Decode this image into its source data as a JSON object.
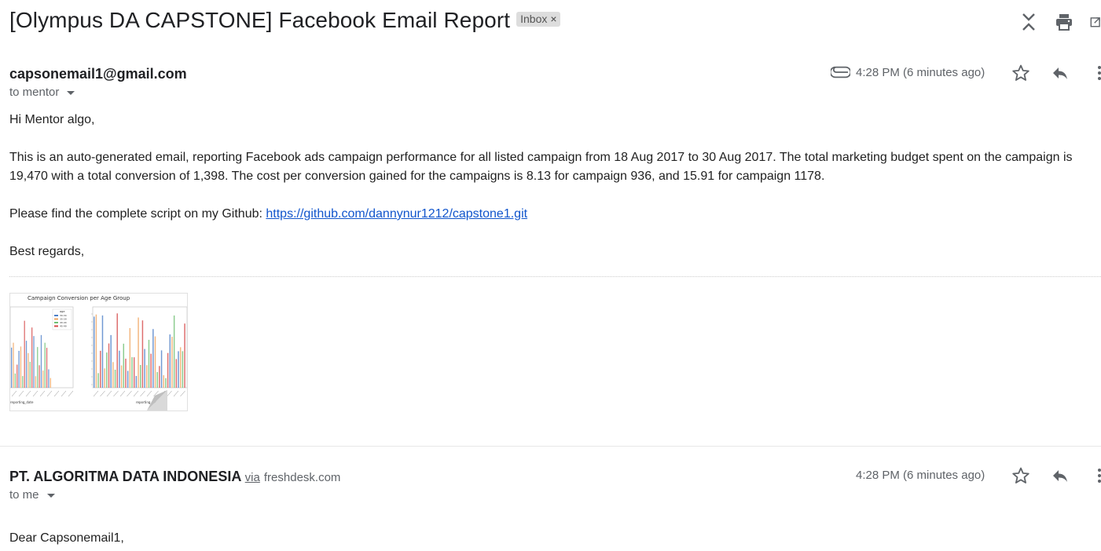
{
  "subject": {
    "title": "[Olympus DA CAPSTONE] Facebook Email Report",
    "label": "Inbox",
    "label_remove": "×"
  },
  "toolbar_icons": [
    "collapse-icon",
    "print-icon",
    "open-in-new-window-icon"
  ],
  "message1": {
    "sender": "capsonemail1@gmail.com",
    "to_label": "to mentor",
    "time": "4:28 PM (6 minutes ago)",
    "attachment_icon": "paperclip-icon",
    "greeting": "Hi Mentor algo,",
    "paragraph1": "This is an auto-generated email, reporting Facebook ads campaign performance for all listed campaign from 18 Aug 2017 to 30 Aug 2017. The total marketing budget spent on the campaign is 19,470 with a total conversion of 1,398. The cost per conversion gained for the campaigns is 8.13 for campaign 936, and 15.91 for campaign 1178.",
    "github_prefix": "Please find the complete script on my Github: ",
    "github_link": "https://github.com/dannynur1212/capstone1.git",
    "closing": "Best regards,",
    "attachment": {
      "chart_title": "Campaign Conversion per Age Group",
      "left_xlabel": "reporting_date",
      "right_xlabel": "reporting_date",
      "legend_title": "age",
      "legend_entries": [
        "30-34",
        "35-39",
        "40-44",
        "45-49"
      ],
      "series_colors": [
        "#4e7fc8",
        "#f0a560",
        "#6fbf73",
        "#d64a4a"
      ]
    }
  },
  "message2": {
    "sender": "PT. ALGORITMA DATA INDONESIA",
    "via": "via",
    "via_domain": "freshdesk.com",
    "to_label": "to me",
    "time": "4:28 PM (6 minutes ago)",
    "greeting": "Dear Capsonemail1,"
  },
  "colors": {
    "link": "#1155cc",
    "icon": "#5f6368",
    "badge_bg": "#dddddd"
  }
}
